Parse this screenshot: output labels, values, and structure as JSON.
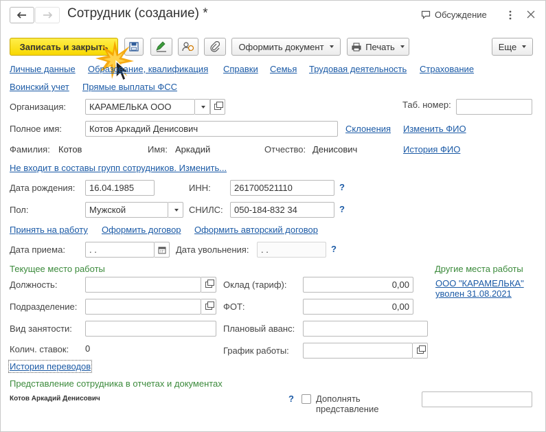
{
  "window": {
    "title": "Сотрудник (создание) *",
    "discussion_label": "Обсуждение",
    "more_icon": "vertical-dots-icon",
    "close_icon": "close-icon"
  },
  "toolbar": {
    "save_close_label": "Записать и закрыть",
    "create_document_label": "Оформить документ",
    "print_label": "Печать",
    "more_label": "Еще"
  },
  "nav_links": [
    "Личные данные",
    "Образование, квалификация",
    "Справки",
    "Семья",
    "Трудовая деятельность",
    "Страхование",
    "Воинский учет",
    "Прямые выплаты ФСС"
  ],
  "organization": {
    "label": "Организация:",
    "value": "КАРАМЕЛЬКА ООО"
  },
  "tab_number": {
    "label": "Таб. номер:",
    "value": ""
  },
  "full_name": {
    "label": "Полное имя:",
    "value": "Котов Аркадий Денисович"
  },
  "name_links": {
    "declension": "Склонения",
    "change": "Изменить ФИО",
    "history": "История ФИО"
  },
  "name_parts": {
    "surname_label": "Фамилия:",
    "surname": "Котов",
    "first_label": "Имя:",
    "first": "Аркадий",
    "patronymic_label": "Отчество:",
    "patronymic": "Денисович"
  },
  "groups_link": "Не входит в составы групп сотрудников. Изменить...",
  "birth_date": {
    "label": "Дата рождения:",
    "value": "16.04.1985"
  },
  "inn": {
    "label": "ИНН:",
    "value": "261700521110"
  },
  "gender": {
    "label": "Пол:",
    "value": "Мужской"
  },
  "snils": {
    "label": "СНИЛС:",
    "value": "050-184-832 34"
  },
  "help_mark": "?",
  "hire_links": {
    "hire": "Принять на работу",
    "contract": "Оформить договор",
    "author_contract": "Оформить авторский договор"
  },
  "hire_date": {
    "label": "Дата приема:",
    "value": " .  . "
  },
  "dismiss_date": {
    "label": "Дата увольнения:",
    "value": " .  . "
  },
  "current_job": {
    "header": "Текущее место работы",
    "position_label": "Должность:",
    "department_label": "Подразделение:",
    "employment_label": "Вид занятости:",
    "rates_label": "Колич. ставок:",
    "rates_value": "0",
    "salary_label": "Оклад (тариф):",
    "salary_value": "0,00",
    "fot_label": "ФОТ:",
    "fot_value": "0,00",
    "advance_label": "Плановый аванс:",
    "schedule_label": "График работы:"
  },
  "other_jobs": {
    "header": "Другие места работы",
    "org_link": "ООО \"КАРАМЕЛЬКА\"",
    "dismissed_link": "уволен 31.08.2021"
  },
  "transfers_link": "История переводов",
  "representation": {
    "header": "Представление сотрудника в отчетах и документах",
    "value": "Котов Аркадий Денисович",
    "supplement_line1": "Дополнять",
    "supplement_line2": "представление"
  },
  "colors": {
    "primary_button": "#f8d800",
    "link": "#1b5aa6",
    "section_header": "#3b8a3b"
  }
}
